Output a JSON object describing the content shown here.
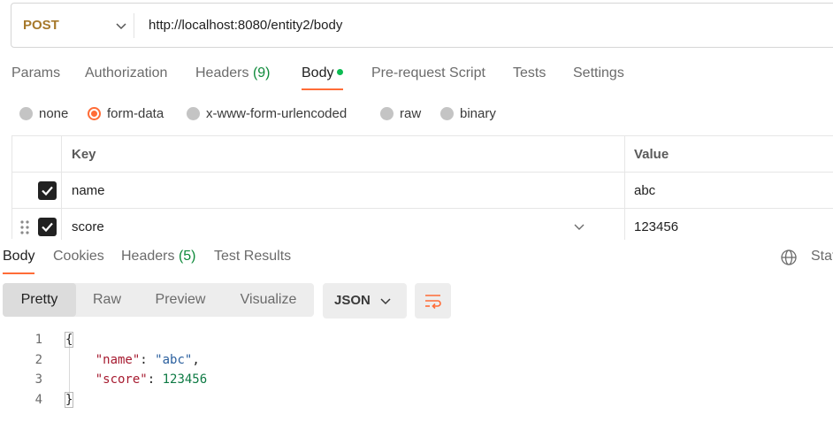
{
  "request": {
    "method": "POST",
    "url": "http://localhost:8080/entity2/body"
  },
  "request_tabs": {
    "params": "Params",
    "authorization": "Authorization",
    "headers": "Headers",
    "headers_count": "(9)",
    "body": "Body",
    "pre_request": "Pre-request Script",
    "tests": "Tests",
    "settings": "Settings"
  },
  "body_types": {
    "none": "none",
    "form_data": "form-data",
    "urlencoded": "x-www-form-urlencoded",
    "raw": "raw",
    "binary": "binary",
    "selected": "form-data"
  },
  "params_table": {
    "key_header": "Key",
    "value_header": "Value",
    "rows": [
      {
        "key": "name",
        "value": "abc",
        "checked": true
      },
      {
        "key": "score",
        "value": "123456",
        "checked": true
      }
    ]
  },
  "response_tabs": {
    "body": "Body",
    "cookies": "Cookies",
    "headers": "Headers",
    "headers_count": "(5)",
    "test_results": "Test Results",
    "status": "Stat"
  },
  "view_modes": {
    "pretty": "Pretty",
    "raw": "Raw",
    "preview": "Preview",
    "visualize": "Visualize",
    "format": "JSON"
  },
  "response_code": {
    "line_numbers": [
      "1",
      "2",
      "3",
      "4"
    ],
    "open_brace": "{",
    "close_brace": "}",
    "key1": "\"name\"",
    "val1": "\"abc\"",
    "key2": "\"score\"",
    "val2": "123456"
  },
  "colors": {
    "accent": "#ff6c37",
    "method": "#a6782a",
    "count_green": "#0e8a3a"
  }
}
